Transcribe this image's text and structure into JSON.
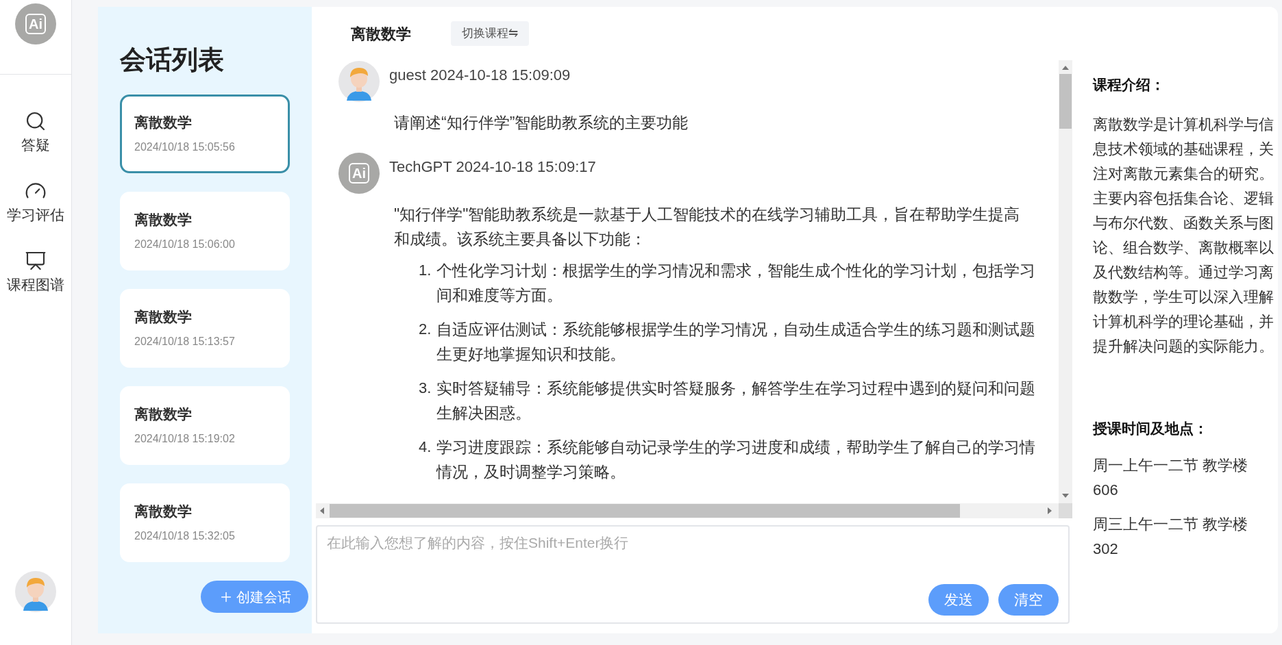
{
  "nav": {
    "logo": "Ai",
    "items": [
      {
        "kind": "search",
        "label": "答疑"
      },
      {
        "kind": "gauge",
        "label": "学习评估"
      },
      {
        "kind": "chart",
        "label": "课程图谱"
      }
    ]
  },
  "sessions": {
    "title": "会话列表",
    "items": [
      {
        "title": "离散数学",
        "time": "2024/10/18 15:05:56",
        "selected": true
      },
      {
        "title": "离散数学",
        "time": "2024/10/18 15:06:00",
        "selected": false
      },
      {
        "title": "离散数学",
        "time": "2024/10/18 15:13:57",
        "selected": false
      },
      {
        "title": "离散数学",
        "time": "2024/10/18 15:19:02",
        "selected": false
      },
      {
        "title": "离散数学",
        "time": "2024/10/18 15:32:05",
        "selected": false
      }
    ],
    "create_button": "创建会话"
  },
  "chat": {
    "course": "离散数学",
    "switch_button": "切换课程⇋",
    "messages": [
      {
        "kind": "user",
        "sender": "guest",
        "time": "2024-10-18 15:09:09",
        "lines": [
          "请阐述“知行伴学”智能助教系统的主要功能"
        ]
      },
      {
        "kind": "assistant",
        "logo": "Ai",
        "sender": "TechGPT",
        "time": "2024-10-18 15:09:17",
        "lines": [
          "\"知行伴学\"智能助教系统是一款基于人工智能技术的在线学习辅助工具，旨在帮助学生提高",
          "和成绩。该系统主要具备以下功能："
        ],
        "list": [
          {
            "number": "1.",
            "lines": [
              "个性化学习计划：根据学生的学习情况和需求，智能生成个性化的学习计划，包括学习",
              "间和难度等方面。"
            ]
          },
          {
            "number": "2.",
            "lines": [
              "自适应评估测试：系统能够根据学生的学习情况，自动生成适合学生的练习题和测试题",
              "生更好地掌握知识和技能。"
            ]
          },
          {
            "number": "3.",
            "lines": [
              "实时答疑辅导：系统能够提供实时答疑服务，解答学生在学习过程中遇到的疑问和问题",
              "生解决困惑。"
            ]
          },
          {
            "number": "4.",
            "lines": [
              "学习进度跟踪：系统能够自动记录学生的学习进度和成绩，帮助学生了解自己的学习情",
              "情况，及时调整学习策略。"
            ]
          }
        ]
      }
    ],
    "input": {
      "placeholder": "在此输入您想了解的内容，按住Shift+Enter换行"
    },
    "buttons": [
      "发送",
      "清空"
    ]
  },
  "info": {
    "intro_title": "课程介绍：",
    "intro": "离散数学是计算机科学与信息技术领域的基础课程，关注对离散元素集合的研究。主要内容包括集合论、逻辑与布尔代数、函数关系与图论、组合数学、离散概率以及代数结构等。通过学习离散数学，学生可以深入理解计算机科学的理论基础，并提升解决问题的实际能力。",
    "schedule_title": "授课时间及地点：",
    "schedule": [
      "周一上午一二节 教学楼 606",
      "周三上午一二节 教学楼 302"
    ]
  }
}
